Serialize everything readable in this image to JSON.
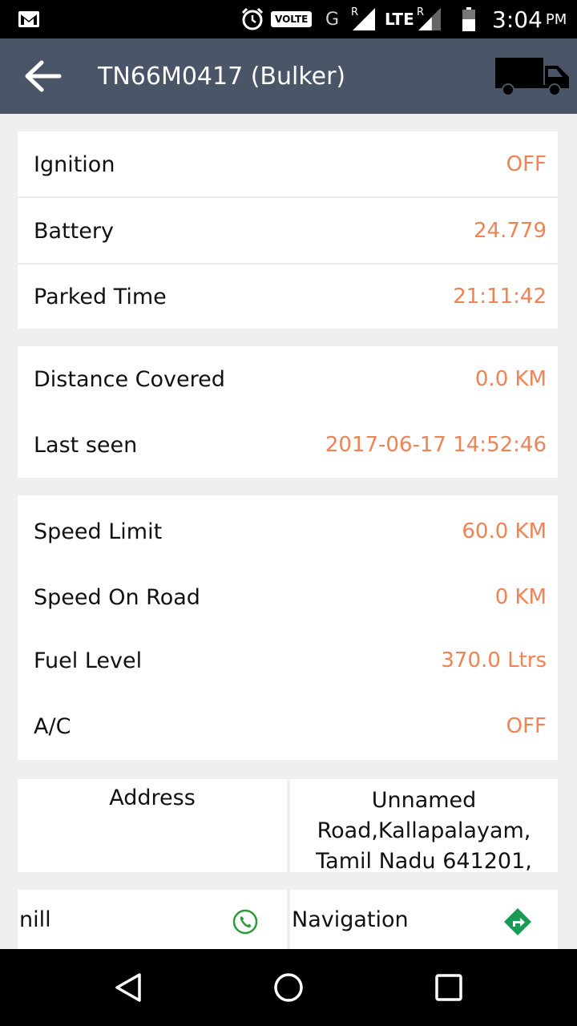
{
  "status_bar": {
    "volte": "VOLTE",
    "g": "G",
    "r1": "R",
    "lte": "LTE",
    "r2": "R",
    "time": "3:04",
    "ampm": "PM"
  },
  "app_bar": {
    "title": "TN66M0417 (Bulker)"
  },
  "card1": [
    {
      "label": "Ignition",
      "value": "OFF"
    },
    {
      "label": "Battery",
      "value": "24.779"
    },
    {
      "label": "Parked Time",
      "value": "21:11:42"
    }
  ],
  "card2": [
    {
      "label": "Distance Covered",
      "value": "0.0 KM"
    },
    {
      "label": "Last seen",
      "value": "2017-06-17 14:52:46"
    }
  ],
  "card3": [
    {
      "label": "Speed Limit",
      "value": "60.0 KM"
    },
    {
      "label": "Speed On Road",
      "value": "0 KM"
    },
    {
      "label": "Fuel Level",
      "value": "370.0 Ltrs"
    },
    {
      "label": "A/C",
      "value": "OFF"
    }
  ],
  "address": {
    "label": "Address",
    "line1": "Unnamed",
    "line2": "Road,Kallapalayam,",
    "line3": "Tamil Nadu 641201,"
  },
  "bottom": {
    "contact": "nill",
    "navigation": "Navigation"
  },
  "colors": {
    "accent": "#ef8354",
    "appbar": "#4a5568"
  }
}
